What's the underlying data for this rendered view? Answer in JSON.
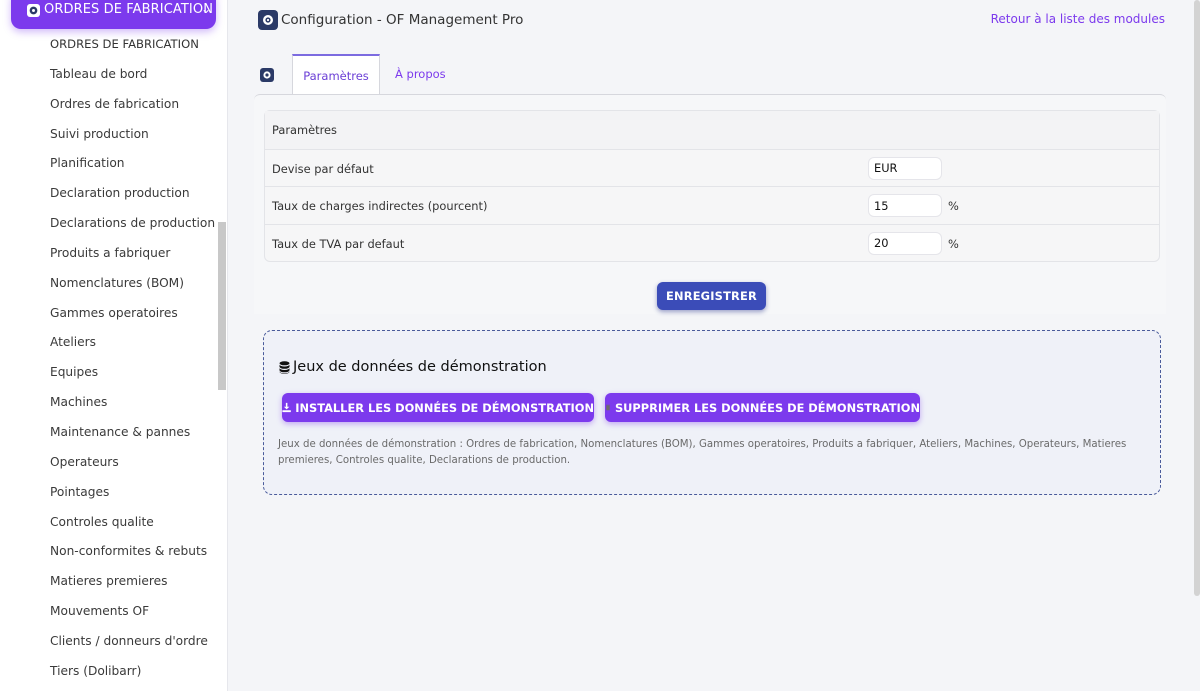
{
  "sidebar": {
    "header_label": "ORDRES DE FABRICATION",
    "items": [
      "ORDRES DE FABRICATION",
      "Tableau de bord",
      "Ordres de fabrication",
      "Suivi production",
      "Planification",
      "Declaration production",
      "Declarations de production",
      "Produits a fabriquer",
      "Nomenclatures (BOM)",
      "Gammes operatoires",
      "Ateliers",
      "Equipes",
      "Machines",
      "Maintenance & pannes",
      "Operateurs",
      "Pointages",
      "Controles qualite",
      "Non-conformites & rebuts",
      "Matieres premieres",
      "Mouvements OF",
      "Clients / donneurs d'ordre",
      "Tiers (Dolibarr)"
    ]
  },
  "header": {
    "title": "Configuration - OF Management Pro",
    "back_link": "Retour à la liste des modules"
  },
  "tabs": [
    {
      "label": "Paramètres",
      "active": true
    },
    {
      "label": "À propos",
      "active": false
    }
  ],
  "params": {
    "header": "Paramètres",
    "rows": [
      {
        "label": "Devise par défaut",
        "value": "EUR",
        "unit": ""
      },
      {
        "label": "Taux de charges indirectes (pourcent)",
        "value": "15",
        "unit": "%"
      },
      {
        "label": "Taux de TVA par defaut",
        "value": "20",
        "unit": "%"
      }
    ],
    "save_label": "ENREGISTRER"
  },
  "demo": {
    "title": "Jeux de données de démonstration",
    "install_label": "INSTALLER LES DONNÉES DE DÉMONSTRATION",
    "remove_label": "SUPPRIMER LES DONNÉES DE DÉMONSTRATION",
    "description": "Jeux de données de démonstration : Ordres de fabrication, Nomenclatures (BOM), Gammes operatoires, Produits a fabriquer, Ateliers, Machines, Operateurs, Matieres premieres, Controles qualite, Declarations de production."
  },
  "colors": {
    "accent": "#7c3aed",
    "save_button": "#3b4cb8",
    "title_icon": "#2b3a67"
  },
  "icons": {
    "menu": "gear-icon",
    "title": "gear-icon",
    "chevron": "chevron-down-icon",
    "demo": "database-icon",
    "install": "download-icon",
    "remove": "trash-icon"
  }
}
